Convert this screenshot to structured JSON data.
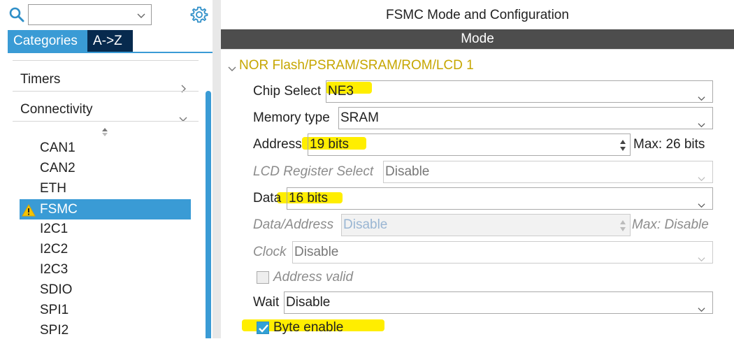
{
  "sidebar": {
    "search_value": "",
    "tabs": [
      {
        "label": "Categories"
      },
      {
        "label": "A->Z"
      }
    ],
    "categories": [
      {
        "label": "Timers"
      },
      {
        "label": "Connectivity"
      }
    ],
    "peripherals": [
      {
        "label": "CAN1"
      },
      {
        "label": "CAN2"
      },
      {
        "label": "ETH"
      },
      {
        "label": "FSMC",
        "selected": true,
        "warning": true
      },
      {
        "label": "I2C1"
      },
      {
        "label": "I2C2"
      },
      {
        "label": "I2C3"
      },
      {
        "label": "SDIO"
      },
      {
        "label": "SPI1"
      },
      {
        "label": "SPI2"
      }
    ]
  },
  "main": {
    "title": "FSMC Mode and Configuration",
    "mode_header": "Mode",
    "section_title": "NOR Flash/PSRAM/SRAM/ROM/LCD 1",
    "fields": {
      "chip_select": {
        "label": "Chip Select",
        "value": "NE3"
      },
      "memory_type": {
        "label": "Memory type",
        "value": "SRAM"
      },
      "address": {
        "label": "Address",
        "value": "19 bits",
        "max": "Max: 26 bits"
      },
      "lcd_register_select": {
        "label": "LCD Register Select",
        "value": "Disable"
      },
      "data": {
        "label": "Data",
        "value": "16 bits"
      },
      "data_address": {
        "label": "Data/Address",
        "value": "Disable",
        "max": "Max: Disable"
      },
      "clock": {
        "label": "Clock",
        "value": "Disable"
      },
      "address_valid": {
        "label": "Address valid",
        "checked": false
      },
      "wait": {
        "label": "Wait",
        "value": "Disable"
      },
      "byte_enable": {
        "label": "Byte enable",
        "checked": true
      }
    }
  },
  "colors": {
    "accent": "#3a9bd5",
    "dark_tab": "#072a4e",
    "mode_bar": "#4d4d4d",
    "section": "#c6a600",
    "highlight": "#ffee00"
  }
}
